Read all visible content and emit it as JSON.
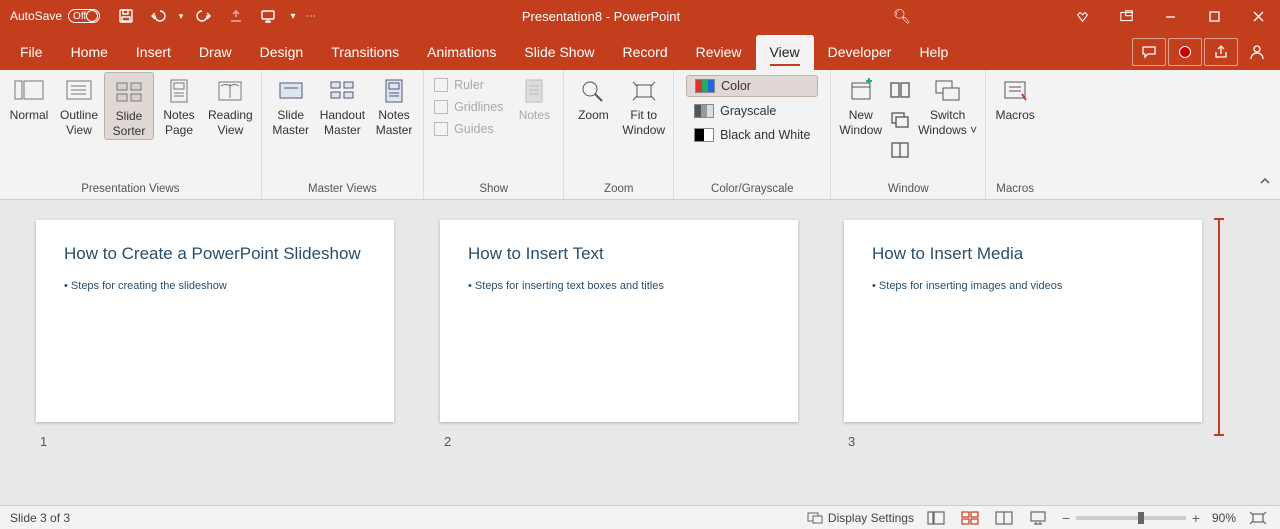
{
  "titlebar": {
    "autosave_label": "AutoSave",
    "autosave_state": "Off",
    "doc_title": "Presentation8  -  PowerPoint"
  },
  "tabs": {
    "file": "File",
    "home": "Home",
    "insert": "Insert",
    "draw": "Draw",
    "design": "Design",
    "transitions": "Transitions",
    "animations": "Animations",
    "slideshow": "Slide Show",
    "record": "Record",
    "review": "Review",
    "view": "View",
    "developer": "Developer",
    "help": "Help"
  },
  "ribbon": {
    "presentation_views": {
      "label": "Presentation Views",
      "normal": "Normal",
      "outline": "Outline\nView",
      "slide_sorter": "Slide\nSorter",
      "notes_page": "Notes\nPage",
      "reading": "Reading\nView"
    },
    "master_views": {
      "label": "Master Views",
      "slide_master": "Slide\nMaster",
      "handout_master": "Handout\nMaster",
      "notes_master": "Notes\nMaster"
    },
    "show": {
      "label": "Show",
      "ruler": "Ruler",
      "gridlines": "Gridlines",
      "guides": "Guides",
      "notes": "Notes"
    },
    "zoom": {
      "label": "Zoom",
      "zoom": "Zoom",
      "fit": "Fit to\nWindow"
    },
    "color": {
      "label": "Color/Grayscale",
      "color": "Color",
      "grayscale": "Grayscale",
      "bw": "Black and White"
    },
    "window": {
      "label": "Window",
      "new_window": "New\nWindow",
      "switch": "Switch\nWindows"
    },
    "macros": {
      "label": "Macros",
      "macros": "Macros"
    }
  },
  "slides": [
    {
      "n": "1",
      "title": "How to Create a PowerPoint Slideshow",
      "bullet": "Steps for creating the slideshow"
    },
    {
      "n": "2",
      "title": "How to Insert Text",
      "bullet": "Steps for inserting text boxes and titles"
    },
    {
      "n": "3",
      "title": "How to Insert Media",
      "bullet": "Steps for inserting images and videos"
    }
  ],
  "status": {
    "slide_info": "Slide 3 of 3",
    "display_settings": "Display Settings",
    "zoom_pct": "90%"
  }
}
